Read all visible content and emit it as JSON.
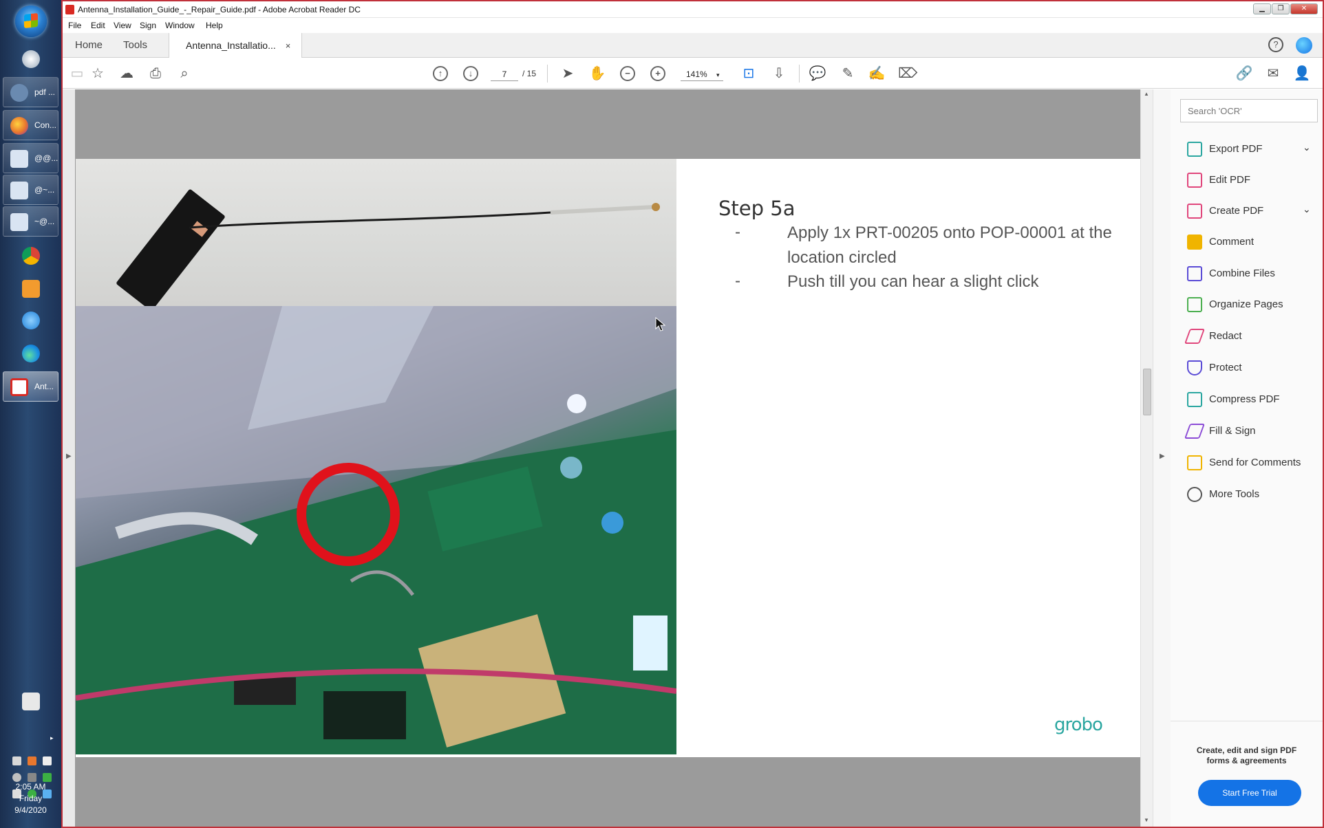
{
  "taskbar": {
    "pinned": [
      {
        "label": "pdf ...",
        "color": "#6a8ab0"
      },
      {
        "label": "Con...",
        "color": "#e8772e"
      },
      {
        "label": "@@...",
        "color": "#d9e4f2"
      },
      {
        "label": "@~...",
        "color": "#d9e4f2"
      },
      {
        "label": "~@...",
        "color": "#d9e4f2"
      },
      {
        "label": "Ant...",
        "color": "#d92a23"
      }
    ],
    "clock": {
      "time": "2:05 AM",
      "day": "Friday",
      "date": "9/4/2020"
    }
  },
  "window": {
    "title": "Antenna_Installation_Guide_-_Repair_Guide.pdf - Adobe Acrobat Reader DC",
    "menu": [
      "File",
      "Edit",
      "View",
      "Sign",
      "Window",
      "Help"
    ]
  },
  "tabs": {
    "home": "Home",
    "tools": "Tools",
    "document": "Antenna_Installatio...",
    "close": "×"
  },
  "toolbar": {
    "page_current": "7",
    "page_total": "/ 15",
    "zoom": "141%"
  },
  "document": {
    "step_title": "Step 5a",
    "bullets": [
      {
        "marker": "-",
        "text": "Apply 1x PRT-00205 onto POP-00001 at the location circled"
      },
      {
        "marker": "-",
        "text": "Push till you can hear a slight click"
      }
    ],
    "logo": "grobo"
  },
  "tools_pane": {
    "search_placeholder": "Search 'OCR'",
    "tools": [
      {
        "label": "Export PDF",
        "color": "#2aa6a0",
        "chevron": true
      },
      {
        "label": "Edit PDF",
        "color": "#e0457b",
        "chevron": false
      },
      {
        "label": "Create PDF",
        "color": "#e0457b",
        "chevron": true
      },
      {
        "label": "Comment",
        "color": "#f0b400",
        "chevron": false
      },
      {
        "label": "Combine Files",
        "color": "#5a4bd6",
        "chevron": false
      },
      {
        "label": "Organize Pages",
        "color": "#4caf50",
        "chevron": false
      },
      {
        "label": "Redact",
        "color": "#e0457b",
        "chevron": false
      },
      {
        "label": "Protect",
        "color": "#5a4bd6",
        "chevron": false
      },
      {
        "label": "Compress PDF",
        "color": "#2aa6a0",
        "chevron": false
      },
      {
        "label": "Fill & Sign",
        "color": "#8b4bd6",
        "chevron": false
      },
      {
        "label": "Send for Comments",
        "color": "#f0b400",
        "chevron": false
      },
      {
        "label": "More Tools",
        "color": "#555555",
        "chevron": false
      }
    ],
    "promo_line1": "Create, edit and sign PDF",
    "promo_line2": "forms & agreements",
    "trial_button": "Start Free Trial"
  }
}
